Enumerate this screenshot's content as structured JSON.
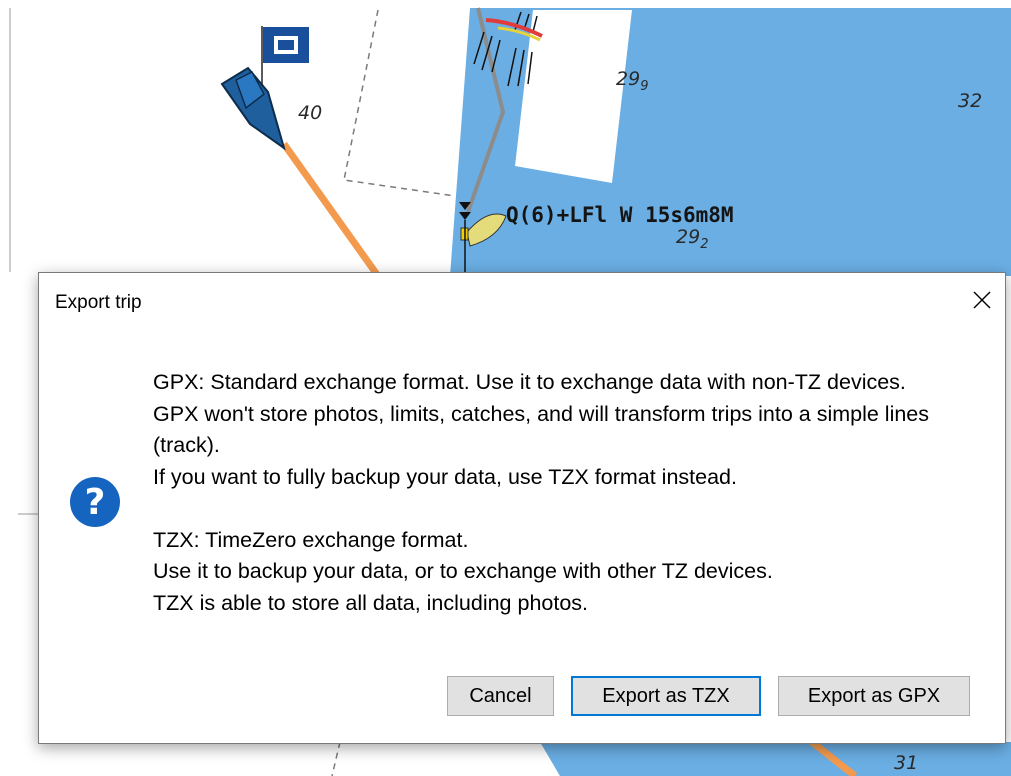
{
  "chart": {
    "soundings": [
      "40",
      "32",
      "29",
      "9",
      "29",
      "2",
      "31"
    ],
    "light_label": "Q(6)+LFl W 15s6m8M"
  },
  "dialog": {
    "title": "Export trip",
    "close_icon": "close-icon",
    "message_icon": "question-icon",
    "message_lines": [
      "GPX: Standard exchange format. Use it to exchange data with non-TZ devices.",
      "GPX won't store photos, limits, catches, and will transform trips into a simple lines (track).",
      "If you want to fully backup your data, use TZX format instead.",
      "",
      "TZX: TimeZero exchange format.",
      "Use it to backup your data, or to exchange with other TZ devices.",
      "TZX is able to store all data, including photos."
    ],
    "buttons": {
      "cancel": "Cancel",
      "export_tzx": "Export as TZX",
      "export_gpx": "Export as GPX"
    }
  },
  "colors": {
    "water": "#6aaee3",
    "route": "#f39a4f",
    "boat": "#1f5f9e",
    "accent": "#0078d7",
    "question_icon": "#1565c0"
  }
}
